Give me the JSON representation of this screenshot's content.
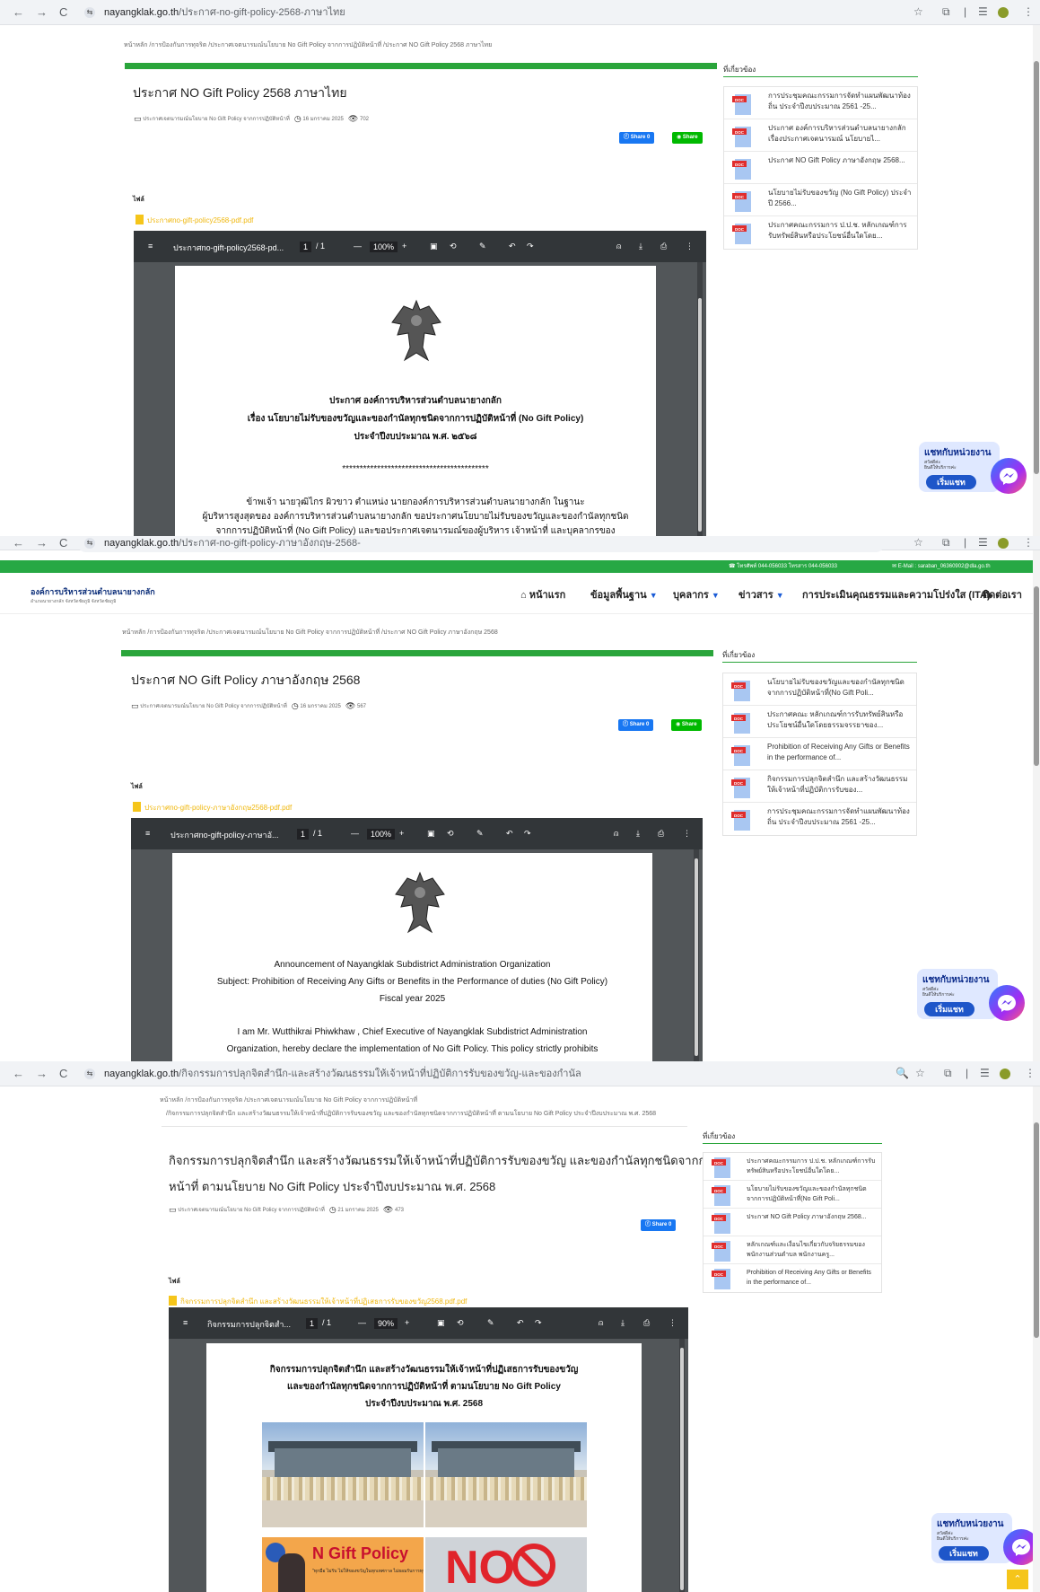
{
  "browser": {
    "nav": {
      "back": "←",
      "forward": "→",
      "reload": "C",
      "tune": "⇆"
    },
    "icons": {
      "star": "☆",
      "ext": "⧉",
      "sep": "|",
      "media": "☰",
      "menu": "⋮",
      "zoom": "🔍"
    }
  },
  "shot1": {
    "url_domain": "nayangklak.go.th",
    "url_path": "/ประกาศ-no-gift-policy-2568-ภาษาไทย",
    "breadcrumb": "หน้าหลัก  /การป้องกันการทุจริต  /ประกาศเจตนารมณ์นโยบาย No Gift Policy จากการปฏิบัติหน้าที่  /ประกาศ NO Gift Policy 2568 ภาษาไทย",
    "title": "ประกาศ NO Gift Policy 2568 ภาษาไทย",
    "category": "ประกาศเจตนารมณ์นโยบาย No Gift Policy จากการปฏิบัติหน้าที่",
    "date": "16 มกราคม 2025",
    "views": "702",
    "file_label": "ไฟล์",
    "file_name": "ประกาศno-gift-policy2568-pdf.pdf",
    "pdf": {
      "name": "ประกาศno-gift-policy2568-pd...",
      "page": "1",
      "pages": "/ 1",
      "zoom": "100%"
    },
    "doc_lines": [
      "ประกาศ องค์การบริหารส่วนตำบลนายางกลัก",
      "เรื่อง นโยบายไม่รับของขวัญและของกำนัลทุกชนิดจากการปฏิบัติหน้าที่ (No Gift Policy)",
      "ประจำปีงบประมาณ พ.ศ. ๒๕๖๘",
      "******************************************",
      "ข้าพเจ้า นายวุฒิไกร ผิวขาว ตำแหน่ง นายกองค์การบริหารส่วนตำบลนายางกลัก ในฐานะ",
      "ผู้บริหารสูงสุดของ องค์การบริหารส่วนตำบลนายางกลัก ขอประกาศนโยบายไม่รับของขวัญและของกำนัลทุกชนิด",
      "จากการปฏิบัติหน้าที่ (No Gift Policy) และขอประกาศเจตนารมณ์ของผู้บริหาร เจ้าหน้าที่ และบุคลากรของ"
    ],
    "related_title": "ที่เกี่ยวข้อง",
    "related": [
      "การประชุมคณะกรรมการจัดทำแผนพัฒนาท้องถิ่น ประจำปีงบประมาณ 2561 -25...",
      "ประกาศ องค์การบริหารส่วนตำบลนายางกลัก เรื่องประกาศเจตนารมณ์ นโยบายไ...",
      "ประกาศ NO Gift Policy ภาษาอังกฤษ 2568...",
      "นโยบายไม่รับของขวัญ (No Gift Policy) ประจำปี 2566...",
      "ประกาศคณะกรรมการ ป.ป.ช. หลักเกณฑ์การรับทรัพย์สินหรือประโยชน์อื่นใดโดย..."
    ]
  },
  "shot2": {
    "url_domain": "nayangklak.go.th",
    "url_path": "/ประกาศ-no-gift-policy-ภาษาอังกฤษ-2568-",
    "phone": "โทรศัพท์ 044-056033 โทรสาร 044-056033",
    "email": "E-Mail : saraban_06360902@dla.go.th",
    "logo": "องค์การบริหารส่วนตำบลนายางกลัก",
    "logo_sub": "อำเภอนายางกลัก จังหวัดชัยภูมิ จังหวัดชัยภูมิ",
    "menu": [
      "หน้าแรก",
      "ข้อมูลพื้นฐาน",
      "บุคลากร",
      "ข่าวสาร",
      "การประเมินคุณธรรมและความโปร่งใส (ITA)",
      "ติดต่อเรา"
    ],
    "breadcrumb": "หน้าหลัก  /การป้องกันการทุจริต  /ประกาศเจตนารมณ์นโยบาย No Gift Policy จากการปฏิบัติหน้าที่  /ประกาศ NO Gift Policy ภาษาอังกฤษ 2568",
    "title": "ประกาศ NO Gift Policy ภาษาอังกฤษ 2568",
    "category": "ประกาศเจตนารมณ์นโยบาย No Gift Policy จากการปฏิบัติหน้าที่",
    "date": "16 มกราคม 2025",
    "views": "567",
    "file_label": "ไฟล์",
    "file_name": "ประกาศno-gift-policy-ภาษาอังกฤษ2568-pdf.pdf",
    "pdf": {
      "name": "ประกาศno-gift-policy-ภาษาอั...",
      "page": "1",
      "pages": "/ 1",
      "zoom": "100%"
    },
    "doc_lines": [
      "Announcement of Nayangklak Subdistrict Administration Organization",
      "Subject: Prohibition of Receiving Any Gifts or Benefits in the Performance of duties (No Gift Policy)",
      "Fiscal year 2025",
      "I am Mr. Wutthikrai Phiwkhaw , Chief Executive of Nayangklak Subdistrict Administration",
      "Organization, hereby declare the implementation of No Gift Policy. This policy strictly prohibits"
    ],
    "related_title": "ที่เกี่ยวข้อง",
    "related": [
      "นโยบายไม่รับของขวัญและของกำนัลทุกชนิดจากการปฏิบัติหน้าที่(No Gift Poli...",
      "ประกาศคณะ หลักเกณฑ์การรับทรัพย์สินหรือประโยชน์อื่นใดโดยธรรมจรรยาของ...",
      "Prohibition of Receiving Any Gifts or Benefits in the performance of...",
      "กิจกรรมการปลุกจิตสำนึก และสร้างวัฒนธรรมให้เจ้าหน้าที่ปฏิบัติการรับของ...",
      "การประชุมคณะกรรมการจัดทำแผนพัฒนาท้องถิ่น ประจำปีงบประมาณ 2561 -25..."
    ]
  },
  "shot3": {
    "url_domain": "nayangklak.go.th",
    "url_path": "/กิจกรรมการปลุกจิตสำนึก-และสร้างวัฒนธรรมให้เจ้าหน้าที่ปฏิบัติการรับของขวัญ-และของกำนัล",
    "breadcrumb_1": "หน้าหลัก  /การป้องกันการทุจริต  /ประกาศเจตนารมณ์นโยบาย No Gift Policy จากการปฏิบัติหน้าที่",
    "breadcrumb_2": "/กิจกรรมการปลุกจิตสำนึก และสร้างวัฒนธรรมให้เจ้าหน้าที่ปฏิบัติการรับของขวัญ และของกำนัลทุกชนิดจากการปฏิบัติหน้าที่ ตามนโยบาย No Gift Policy ประจำปีงบประมาณ พ.ศ. 2568",
    "title_1": "กิจกรรมการปลุกจิตสำนึก และสร้างวัฒนธรรมให้เจ้าหน้าที่ปฏิบัติการรับของขวัญ และของกำนัลทุกชนิดจากการปฏิบัติ",
    "title_2": "หน้าที่ ตามนโยบาย No Gift Policy ประจำปีงบประมาณ พ.ศ. 2568",
    "category": "ประกาศเจตนารมณ์นโยบาย No Gift Policy จากการปฏิบัติหน้าที่",
    "date": "21 มกราคม 2025",
    "views": "473",
    "file_label": "ไฟล์",
    "file_name": "กิจกรรมการปลุกจิตสำนึก และสร้างวัฒนธรรมให้เจ้าหน้าที่ปฏิเสธการรับของขวัญ2568.pdf.pdf",
    "pdf": {
      "name": "กิจกรรมการปลุกจิตสำ...",
      "page": "1",
      "pages": "/ 1",
      "zoom": "90%"
    },
    "doc_lines": [
      "กิจกรรมการปลุกจิตสำนึก และสร้างวัฒนธรรมให้เจ้าหน้าที่ปฏิเสธการรับของขวัญ",
      "และของกำนัลทุกชนิดจากการปฏิบัติหน้าที่ ตามนโยบาย No Gift Policy",
      "ประจำปีงบประมาณ พ.ศ. 2568"
    ],
    "poster_text": "N  Gift  Policy",
    "poster_sub": "\"ทุกมือ ไม่รับ ไม่ให้ของขวัญในทุกเทศกาล ไม่ยอมรับการทุจริต\"",
    "no_sign": "NO",
    "related_title": "ที่เกี่ยวข้อง",
    "related": [
      "ประกาศคณะกรรมการ ป.ป.ช. หลักเกณฑ์การรับทรัพย์สินหรือประโยชน์อื่นใดโดย...",
      "นโยบายไม่รับของขวัญและของกำนัลทุกชนิดจากการปฏิบัติหน้าที่(No Gift Poli...",
      "ประกาศ NO Gift Policy ภาษาอังกฤษ 2568...",
      "หลักเกณฑ์และเงื่อนไขเกี่ยวกับจริยธรรมของพนักงานส่วนตำบล พนักงานครู...",
      "Prohibition of Receiving Any Gifts or Benefits in the performance of..."
    ]
  },
  "share": {
    "facebook": "Share 0",
    "line": "Share"
  },
  "chat": {
    "heading": "แชทกับหน่วยงาน",
    "sub_1": "สวัสดีค่ะ",
    "sub_2": "ยินดีให้บริการค่ะ",
    "button": "เริ่มแชท"
  },
  "doc_badge": "DOC",
  "colors": {
    "green": "#2aa53b",
    "facebook": "#1877f2",
    "line": "#00b900",
    "file_link": "#f0b80f",
    "pdf_bar": "#323639",
    "pdf_bg": "#525659",
    "nav_blue": "#0d2f7a"
  }
}
